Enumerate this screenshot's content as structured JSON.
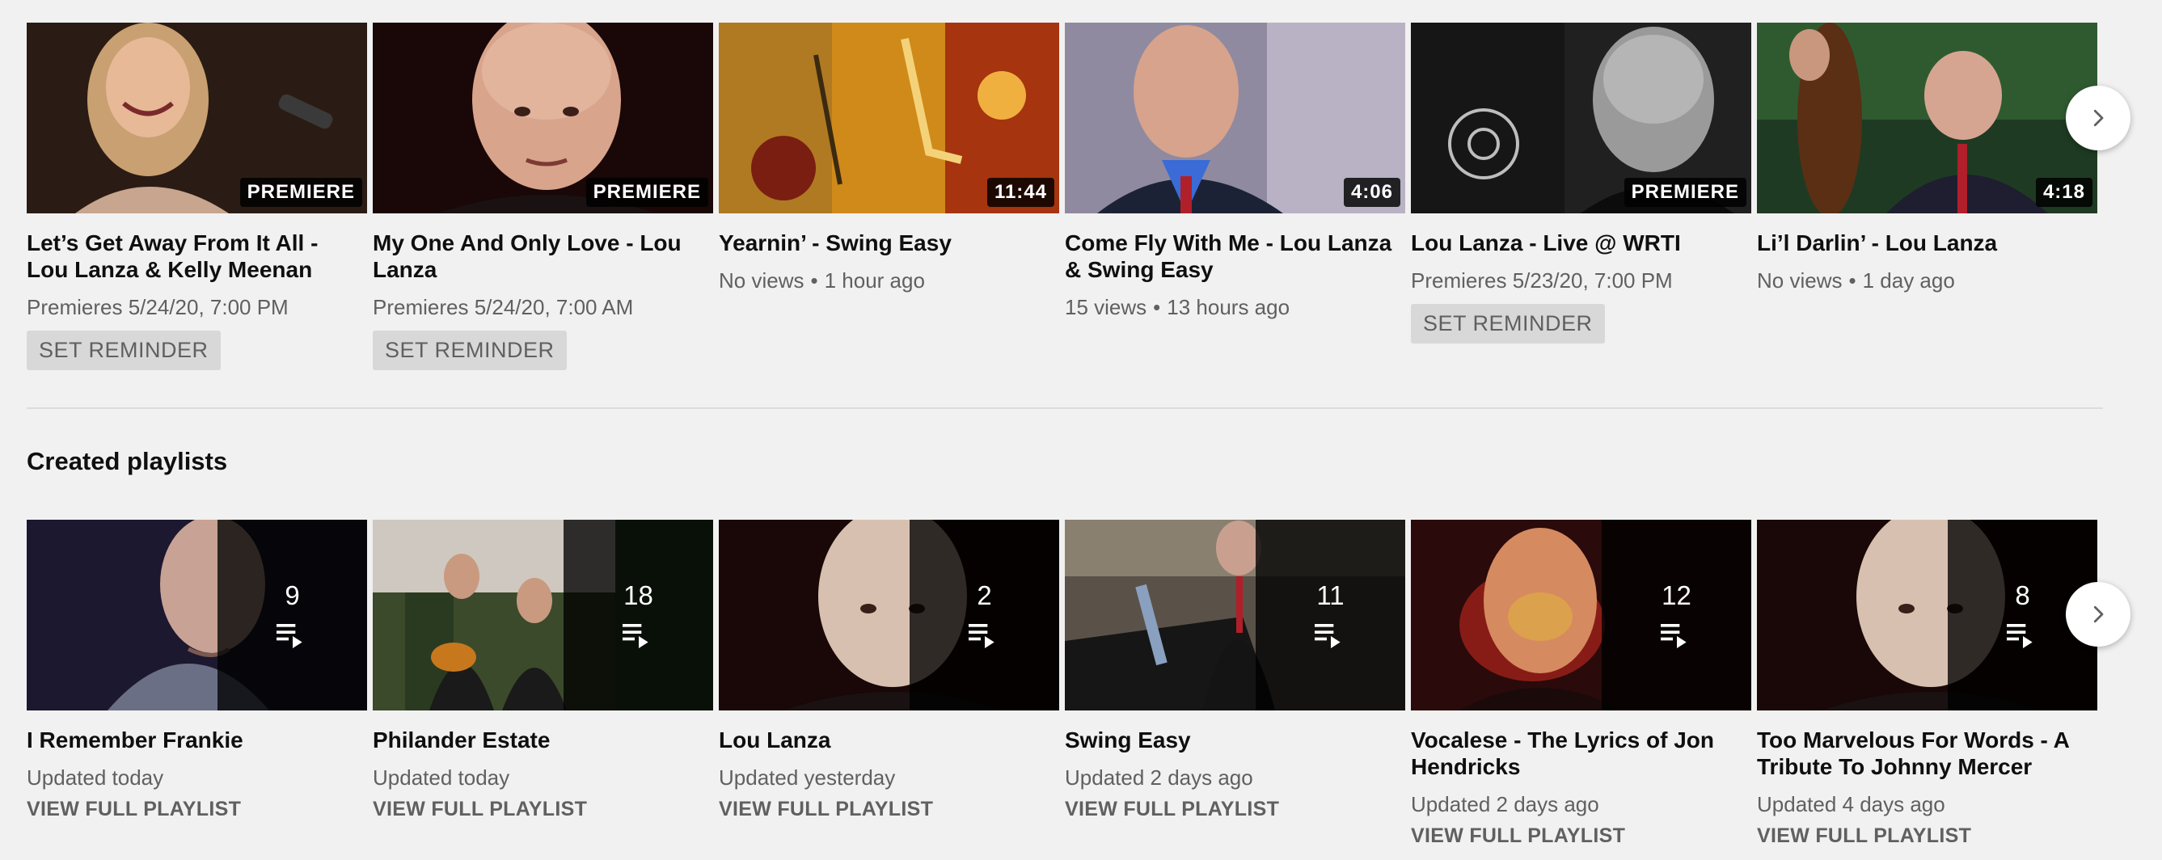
{
  "uploads": {
    "videos": [
      {
        "title": "Let’s Get Away From It All - Lou Lanza & Kelly Meenan",
        "badge": "PREMIERE",
        "meta": "Premieres 5/24/20, 7:00 PM",
        "action": "SET REMINDER"
      },
      {
        "title": "My One And Only Love - Lou Lanza",
        "badge": "PREMIERE",
        "meta": "Premieres 5/24/20, 7:00 AM",
        "action": "SET REMINDER"
      },
      {
        "title": "Yearnin’ - Swing Easy",
        "badge": "11:44",
        "views": "No views",
        "age": "1 hour ago"
      },
      {
        "title": "Come Fly With Me - Lou Lanza & Swing Easy",
        "badge": "4:06",
        "views": "15 views",
        "age": "13 hours ago"
      },
      {
        "title": "Lou Lanza - Live @ WRTI",
        "badge": "PREMIERE",
        "meta": "Premieres 5/23/20, 7:00 PM",
        "action": "SET REMINDER"
      },
      {
        "title": "Li’l Darlin’ - Lou Lanza",
        "badge": "4:18",
        "views": "No views",
        "age": "1 day ago"
      }
    ]
  },
  "playlists": {
    "section_title": "Created playlists",
    "items": [
      {
        "title": "I Remember Frankie",
        "count": "9",
        "updated": "Updated today",
        "action": "VIEW FULL PLAYLIST"
      },
      {
        "title": "Philander Estate",
        "count": "18",
        "updated": "Updated today",
        "action": "VIEW FULL PLAYLIST"
      },
      {
        "title": "Lou Lanza",
        "count": "2",
        "updated": "Updated yesterday",
        "action": "VIEW FULL PLAYLIST"
      },
      {
        "title": "Swing Easy",
        "count": "11",
        "updated": "Updated 2 days ago",
        "action": "VIEW FULL PLAYLIST"
      },
      {
        "title": "Vocalese - The Lyrics of Jon Hendricks",
        "count": "12",
        "updated": "Updated 2 days ago",
        "action": "VIEW FULL PLAYLIST"
      },
      {
        "title": "Too Marvelous For Words - A Tribute To Johnny Mercer",
        "count": "8",
        "updated": "Updated 4 days ago",
        "action": "VIEW FULL PLAYLIST"
      }
    ]
  },
  "icons": {
    "next": "chevron-right-icon",
    "playlist": "playlist-play-icon"
  },
  "colors": {
    "background": "#f1f1f1",
    "meta": "#606060",
    "reminder_bg": "#d8d8d8"
  }
}
